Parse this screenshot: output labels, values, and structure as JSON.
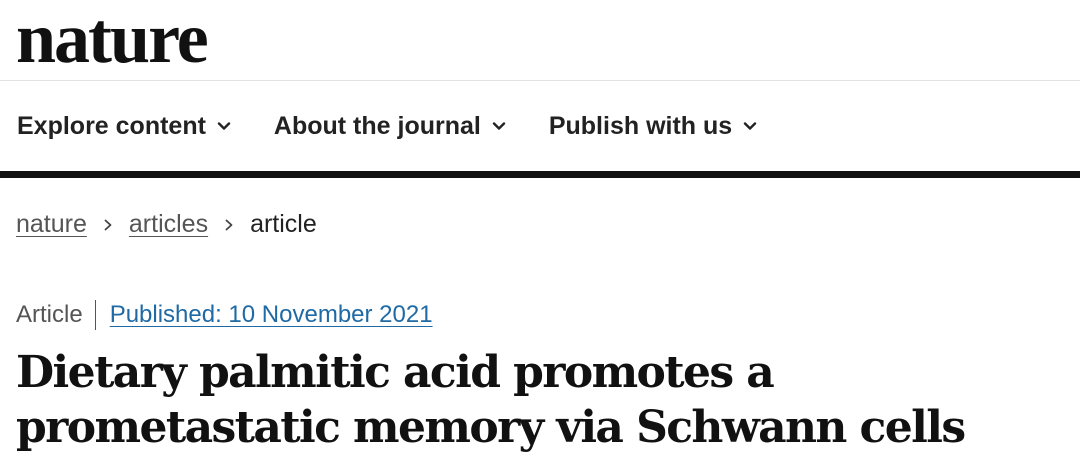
{
  "header": {
    "logo_text": "nature"
  },
  "nav": {
    "items": [
      {
        "label": "Explore content",
        "icon": "chevron-down-icon"
      },
      {
        "label": "About the journal",
        "icon": "chevron-down-icon"
      },
      {
        "label": "Publish with us",
        "icon": "chevron-down-icon"
      }
    ]
  },
  "breadcrumb": {
    "items": [
      {
        "label": "nature",
        "link": true
      },
      {
        "label": "articles",
        "link": true
      },
      {
        "label": "article",
        "link": false
      }
    ],
    "separator_icon": "chevron-right-icon"
  },
  "article": {
    "type": "Article",
    "published": "Published: 10 November 2021",
    "title": "Dietary palmitic acid promotes a prometastatic memory via Schwann cells"
  },
  "colors": {
    "text": "#222222",
    "link_blue": "#1f6aa5",
    "nav_border": "#111111",
    "muted": "#555555"
  }
}
